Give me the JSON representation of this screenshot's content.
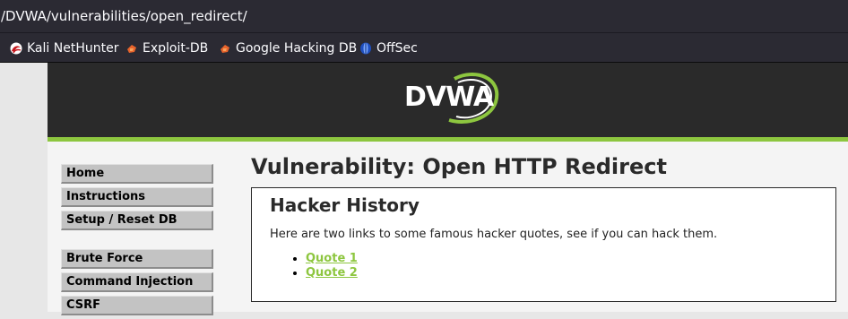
{
  "browser": {
    "url": "/DVWA/vulnerabilities/open_redirect/",
    "bookmarks": [
      {
        "label": "Kali NetHunter",
        "icon": "kali-nethunter-icon"
      },
      {
        "label": "Exploit-DB",
        "icon": "exploit-db-icon"
      },
      {
        "label": "Google Hacking DB",
        "icon": "ghdb-icon"
      },
      {
        "label": "OffSec",
        "icon": "offsec-icon"
      }
    ]
  },
  "header": {
    "logo_text": "DVWA",
    "accent_color": "#8dc63f",
    "background_color": "#2a2a2a"
  },
  "menu": {
    "items": [
      {
        "label": "Home"
      },
      {
        "label": "Instructions"
      },
      {
        "label": "Setup / Reset DB"
      },
      {
        "label": "Brute Force"
      },
      {
        "label": "Command Injection"
      },
      {
        "label": "CSRF"
      }
    ]
  },
  "main": {
    "title": "Vulnerability: Open HTTP Redirect",
    "box": {
      "heading": "Hacker History",
      "description": "Here are two links to some famous hacker quotes, see if you can hack them.",
      "links": [
        {
          "label": "Quote 1"
        },
        {
          "label": "Quote 2"
        }
      ]
    }
  }
}
